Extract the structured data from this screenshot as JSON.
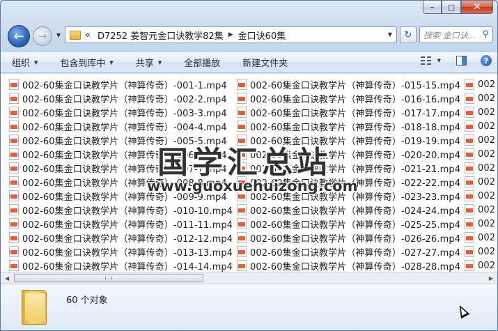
{
  "window": {
    "buttons": {
      "minimize": "–",
      "maximize": "□",
      "close": "✕"
    }
  },
  "nav": {
    "back_glyph": "←",
    "forward_glyph": "→",
    "breadcrumb_overflow": "«",
    "breadcrumbs": [
      "D7252 姜智元金口诀教学82集",
      "金口诀60集"
    ],
    "refresh_glyph": "↻",
    "search_placeholder": "搜索 金口诀..."
  },
  "toolbar": {
    "items": [
      {
        "label": "组织",
        "has_dropdown": true
      },
      {
        "label": "包含到库中",
        "has_dropdown": true
      },
      {
        "label": "共享",
        "has_dropdown": true
      },
      {
        "label": "全部播放",
        "has_dropdown": false
      },
      {
        "label": "新建文件夹",
        "has_dropdown": false
      }
    ],
    "help_glyph": "?"
  },
  "files": {
    "column1": [
      "002-60集金口诀教学片（神算传奇）-001-1.mp4",
      "002-60集金口诀教学片（神算传奇）-002-2.mp4",
      "002-60集金口诀教学片（神算传奇）-003-3.mp4",
      "002-60集金口诀教学片（神算传奇）-004-4.mp4",
      "002-60集金口诀教学片（神算传奇）-005-5.mp4",
      "002-60集金口诀教学片（神算传奇）-006-6.mp4",
      "002-60集金口诀教学片（神算传奇）-007-7.mp4",
      "002-60集金口诀教学片（神算传奇）-008-8.mp4",
      "002-60集金口诀教学片（神算传奇）-009-9.mp4",
      "002-60集金口诀教学片（神算传奇）-010-10.mp4",
      "002-60集金口诀教学片（神算传奇）-011-11.mp4",
      "002-60集金口诀教学片（神算传奇）-012-12.mp4",
      "002-60集金口诀教学片（神算传奇）-013-13.mp4",
      "002-60集金口诀教学片（神算传奇）-014-14.mp4"
    ],
    "column2": [
      "002-60集金口诀教学片（神算传奇）-015-15.mp4",
      "002-60集金口诀教学片（神算传奇）-016-16.mp4",
      "002-60集金口诀教学片（神算传奇）-017-17.mp4",
      "002-60集金口诀教学片（神算传奇）-018-18.mp4",
      "002-60集金口诀教学片（神算传奇）-019-19.mp4",
      "002-60集金口诀教学片（神算传奇）-020-20.mp4",
      "002-60集金口诀教学片（神算传奇）-021-21.mp4",
      "002-60集金口诀教学片（神算传奇）-022-22.mp4",
      "002-60集金口诀教学片（神算传奇）-023-23.mp4",
      "002-60集金口诀教学片（神算传奇）-024-24.mp4",
      "002-60集金口诀教学片（神算传奇）-025-25.mp4",
      "002-60集金口诀教学片（神算传奇）-026-26.mp4",
      "002-60集金口诀教学片（神算传奇）-027-27.mp4",
      "002-60集金口诀教学片（神算传奇）-028-28.mp4"
    ],
    "column3_partial": [
      "002",
      "002",
      "002",
      "002",
      "002",
      "002",
      "002",
      "002",
      "002",
      "002",
      "002",
      "002",
      "002",
      "002"
    ]
  },
  "watermark": {
    "title": "国学汇总站",
    "url": "www.guoxuehuizong.com"
  },
  "details": {
    "count_text": "60 个对象"
  },
  "colors": {
    "frame": "#c4d6ea",
    "content_bg": "#ffffff",
    "close_button": "#c13a1e",
    "file_icon_accent": "#e0603a"
  }
}
